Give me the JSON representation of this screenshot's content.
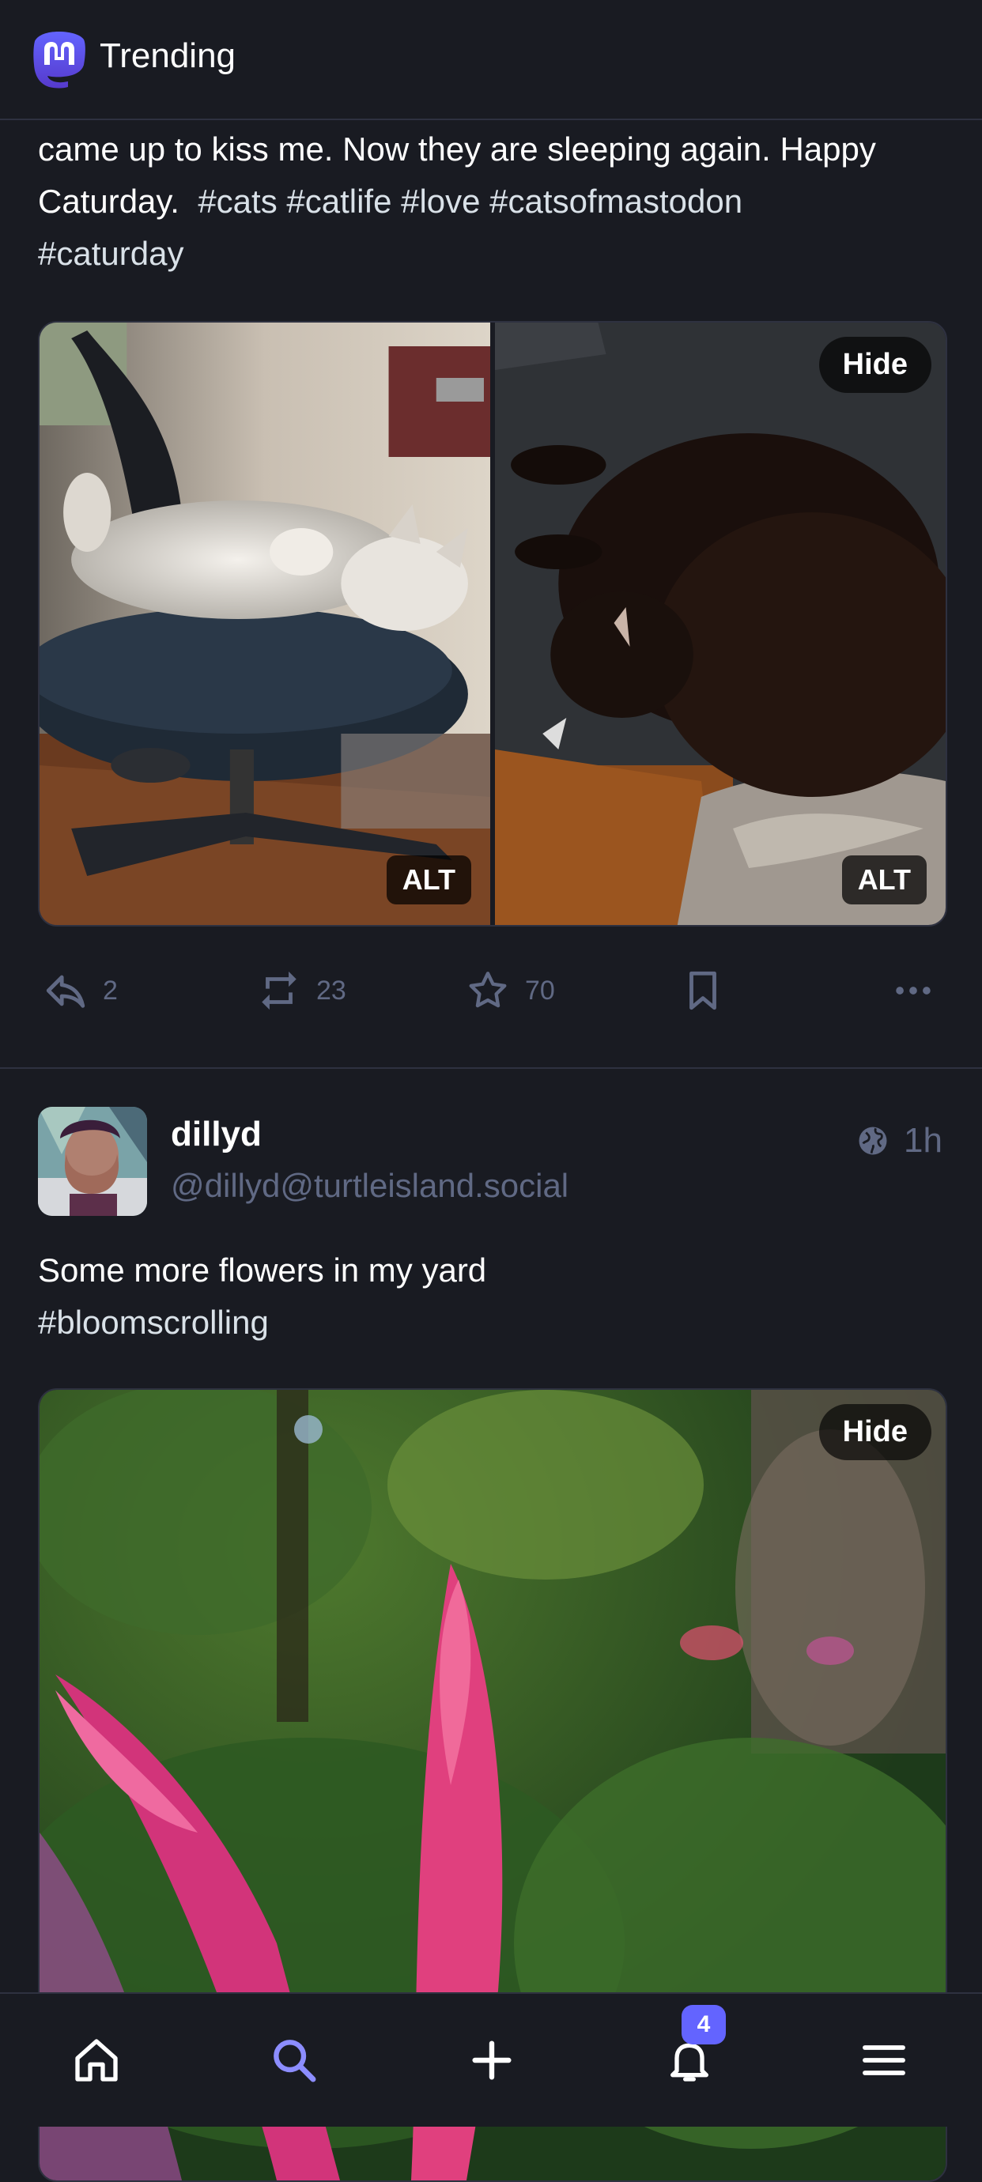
{
  "header": {
    "title": "Trending",
    "logo": "mastodon-logo"
  },
  "post1": {
    "text_line1": "came up to kiss me. Now they are sleeping again. Happy",
    "text_line2_plain": "Caturday. ",
    "hashtags_line2": "#cats #catlife #love #catsofmastodon",
    "hashtags_line3": "#caturday",
    "media": [
      {
        "alt_label": "ALT",
        "subject": "white cat on office chair"
      },
      {
        "alt_label": "ALT",
        "subject": "black cat on floor"
      }
    ],
    "hide_label": "Hide",
    "actions": {
      "reply_count": "2",
      "boost_count": "23",
      "favourite_count": "70"
    }
  },
  "post2": {
    "display_name": "dillyd",
    "handle": "@dillyd@turtleisland.social",
    "time": "1h",
    "text_line1": "Some more flowers in my yard",
    "text_line2": "#bloomscrolling",
    "hide_label": "Hide"
  },
  "bottom_nav": {
    "items": [
      "home-icon",
      "search-icon",
      "compose-icon",
      "notifications-icon",
      "menu-icon"
    ],
    "notification_badge": "4"
  },
  "colors": {
    "background": "#191b22",
    "accent": "#6364ff",
    "muted": "#606984",
    "divider": "#2e3140"
  }
}
